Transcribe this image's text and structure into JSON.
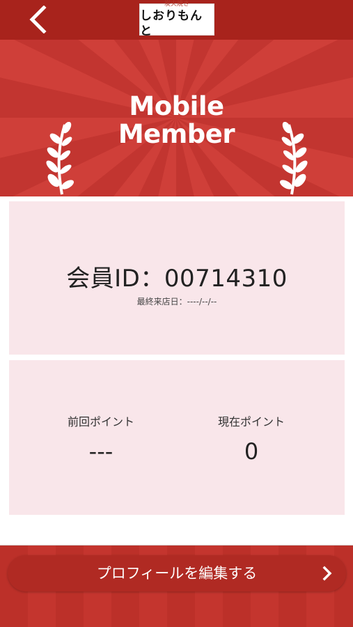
{
  "header": {
    "back_icon": "chevron-left-icon",
    "logo_small": "炭火焼き",
    "logo_main": "しおりもんと"
  },
  "hero": {
    "title_line1": "Mobile",
    "title_line2": "Member",
    "background_color": "#cf3f39",
    "left_icon": "laurel-left-icon",
    "right_icon": "laurel-right-icon"
  },
  "member": {
    "id_text": "会員ID：00714310",
    "last_visit": "最終来店日：----/--/--"
  },
  "points": {
    "previous_label": "前回ポイント",
    "previous_value": "---",
    "current_label": "現在ポイント",
    "current_value": "0"
  },
  "footer": {
    "edit_profile_label": "プロフィールを編集する",
    "chevron_icon": "chevron-right-icon"
  },
  "colors": {
    "topbar": "#a8231c",
    "card": "#f9e6ea",
    "button": "#b02a23"
  }
}
